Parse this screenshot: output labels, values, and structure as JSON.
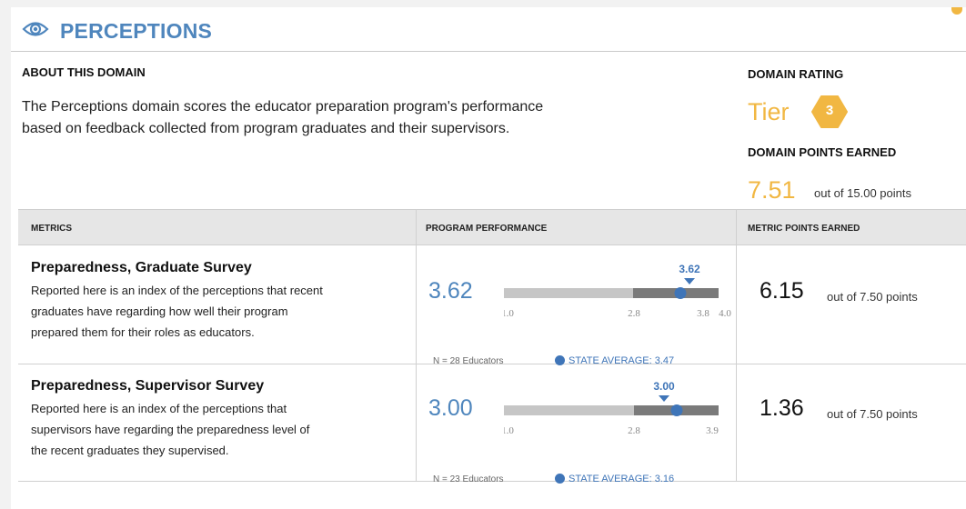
{
  "domain": {
    "title": "PERCEPTIONS",
    "icon": "eye-icon",
    "accent_color": "#4f86bd",
    "rating_color": "#f1b742"
  },
  "about": {
    "heading": "ABOUT THIS DOMAIN",
    "text_line1": "The Perceptions domain scores the educator preparation program's performance",
    "text_line2": "based on feedback collected from program graduates and their supervisors."
  },
  "rating": {
    "heading": "DOMAIN RATING",
    "tier_label": "Tier",
    "tier_value": "3",
    "points_heading": "DOMAIN POINTS EARNED",
    "points_value": "7.51",
    "points_out_of": "out of 15.00 points"
  },
  "table": {
    "col_metrics": "METRICS",
    "col_performance": "PROGRAM PERFORMANCE",
    "col_points": "METRIC POINTS EARNED"
  },
  "metrics": [
    {
      "name": "Preparedness, Graduate Survey",
      "desc_line1": "Reported here is an index of the perceptions that recent",
      "desc_line2": "graduates have regarding how well their program",
      "desc_line3": "prepared them for their roles as educators.",
      "value": "3.62",
      "marker_label": "3.62",
      "scale_min": "1.0",
      "scale_mid": "2.8",
      "scale_high": "3.8",
      "scale_max": "4.0",
      "n_text": "N = 28 Educators",
      "state_average": "STATE AVERAGE: 3.47",
      "points": "6.15",
      "points_out_of": "out of 7.50 points"
    },
    {
      "name": "Preparedness, Supervisor Survey",
      "desc_line1": "Reported here is an index of the perceptions that",
      "desc_line2": "supervisors have regarding the preparedness level of",
      "desc_line3": "the recent graduates they supervised.",
      "value": "3.00",
      "marker_label": "3.00",
      "scale_min": "1.0",
      "scale_mid": "2.8",
      "scale_max": "3.9",
      "n_text": "N = 23 Educators",
      "state_average": "STATE AVERAGE: 3.16",
      "points": "1.36",
      "points_out_of": "out of 7.50 points"
    }
  ]
}
